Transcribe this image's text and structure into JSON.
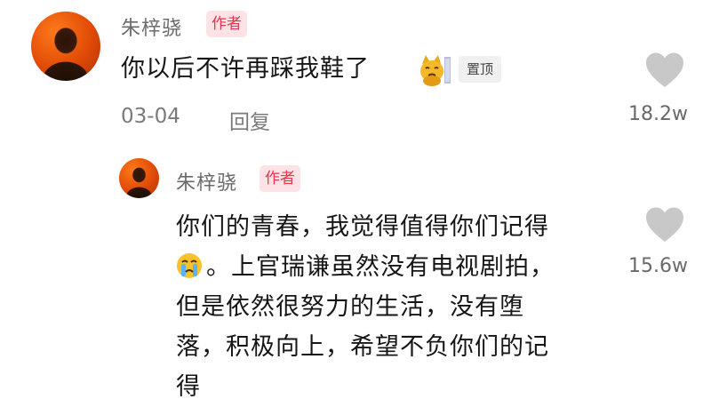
{
  "comment": {
    "author": "朱梓骁",
    "author_badge": "作者",
    "text": "你以后不许再踩我鞋了",
    "pinned_label": "置顶",
    "date": "03-04",
    "reply_label": "回复",
    "like_count": "18.2w",
    "emoji": "cat-emoji"
  },
  "reply": {
    "author": "朱梓骁",
    "author_badge": "作者",
    "lines": [
      "你们的青春，我觉得值得你们记得",
      "。上官瑞谦虽然没有电视剧拍，",
      "但是依然很努力的生活，没有堕",
      "落，积极向上，希望不负你们的记",
      "得"
    ],
    "emoji": "crying-face-emoji",
    "like_count": "15.6w"
  },
  "colors": {
    "badge_bg": "#fde3e6",
    "badge_text": "#e8344c",
    "heart": "#c8c8c8",
    "avatar": "#e04a06"
  }
}
